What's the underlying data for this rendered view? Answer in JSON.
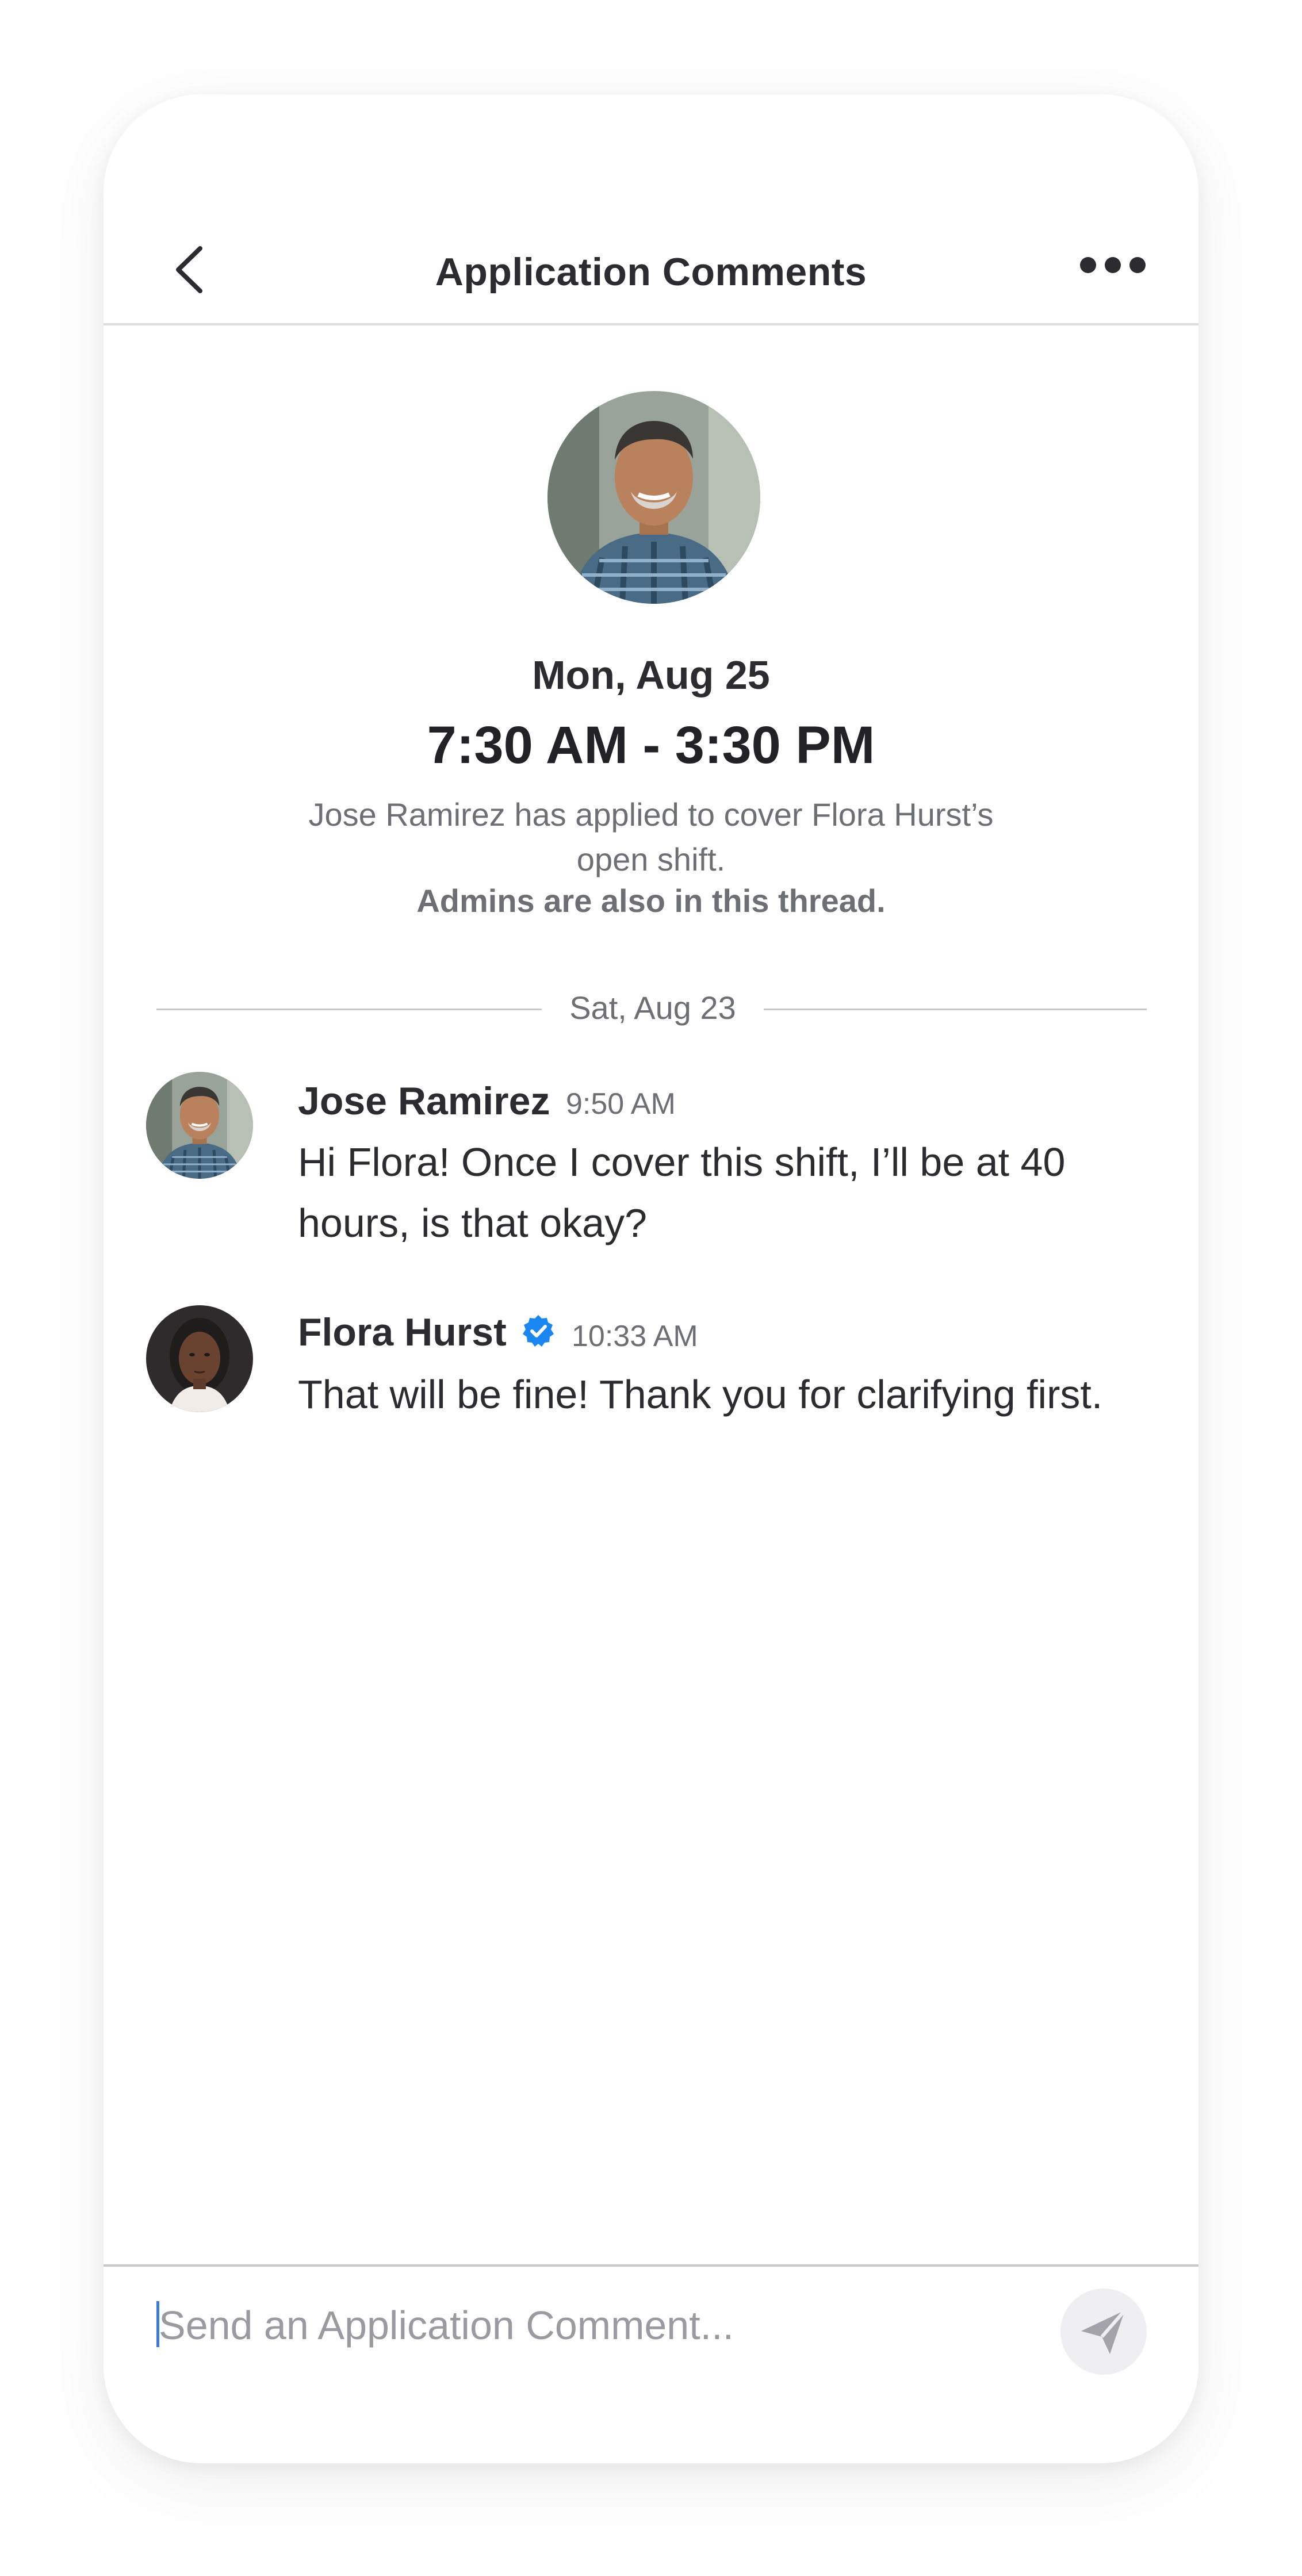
{
  "header": {
    "title": "Application Comments",
    "back_icon": "chevron-left-icon",
    "more_icon": "more-horizontal-icon"
  },
  "shift": {
    "date": "Mon, Aug 25",
    "time_range": "7:30 AM - 3:30 PM",
    "description": "Jose Ramirez has applied to cover Flora Hurst’s open shift.",
    "note": "Admins are also in this thread."
  },
  "thread": {
    "date_divider": "Sat, Aug 23",
    "messages": [
      {
        "author": "Jose Ramirez",
        "time": "9:50 AM",
        "verified": false,
        "text": "Hi Flora! Once I cover this shift, I’ll be at 40 hours, is that okay?"
      },
      {
        "author": "Flora Hurst",
        "time": "10:33 AM",
        "verified": true,
        "text": "That will be fine! Thank you for clarifying first."
      }
    ]
  },
  "composer": {
    "placeholder": "Send an Application Comment...",
    "value": "",
    "send_icon": "send-icon"
  },
  "colors": {
    "text_primary": "#2b2b30",
    "text_secondary": "#6e6e75",
    "verified_badge": "#1a86f0",
    "divider": "#c9c9cd",
    "send_button_bg": "#efeff2"
  }
}
